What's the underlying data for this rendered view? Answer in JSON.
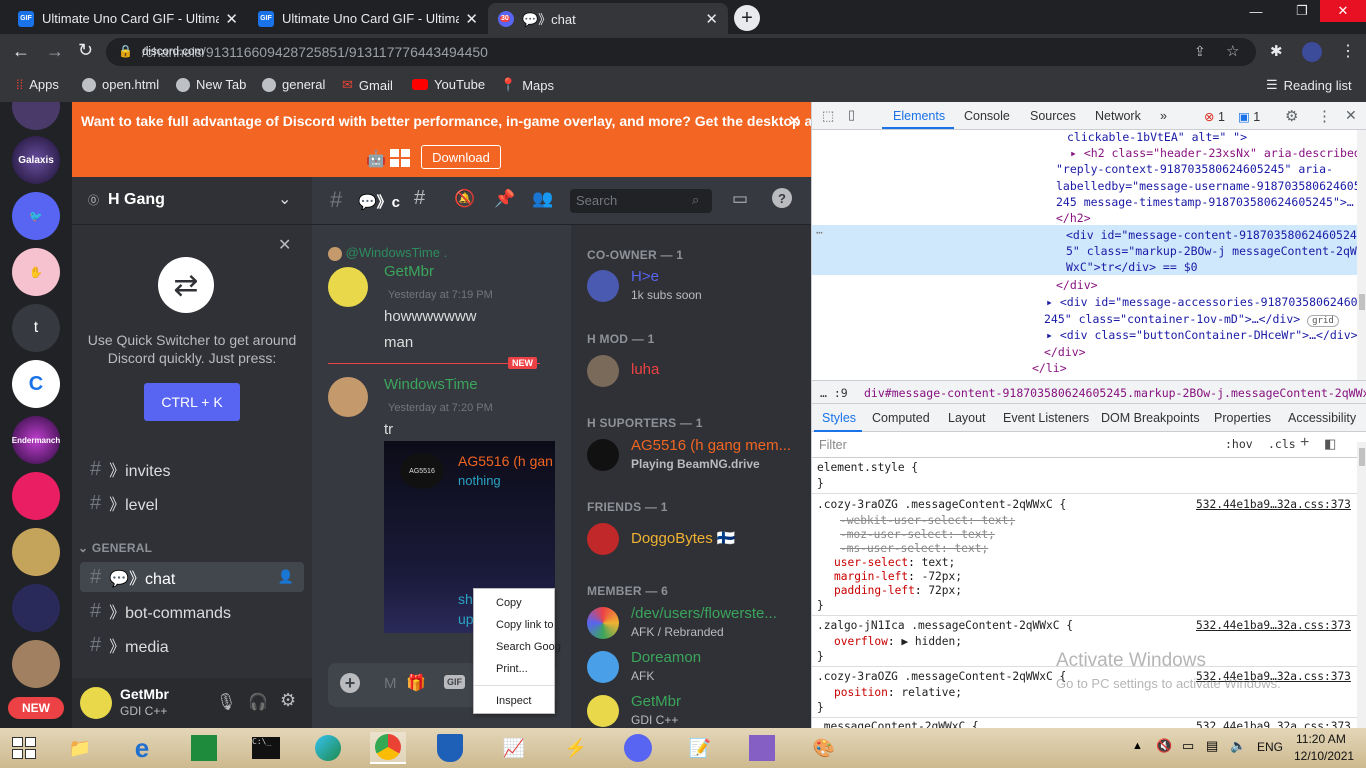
{
  "browser": {
    "tabs": [
      {
        "title": "Ultimate Uno Card GIF - Ultimate",
        "favicon": "GIF",
        "active": false
      },
      {
        "title": "Ultimate Uno Card GIF - Ultimate",
        "favicon": "GIF",
        "active": false
      },
      {
        "title": "💬》chat",
        "favicon": "30",
        "active": true
      }
    ],
    "url_domain": "discord.com",
    "url_path": "/channels/913116609428725851/913117776443494450",
    "bookmarks": [
      "Apps",
      "open.html",
      "New Tab",
      "general",
      "Gmail",
      "YouTube",
      "Maps"
    ],
    "reading_list": "Reading list"
  },
  "discord": {
    "banner": {
      "text": "Want to take full advantage of Discord with better performance, in-game overlay, and more? Get the desktop app!",
      "download": "Download"
    },
    "server_name": "H Gang",
    "channel_header": "💬》ch",
    "search_placeholder": "Search",
    "quick_switcher": {
      "text": "Use Quick Switcher to get around Discord quickly. Just press:",
      "button": "CTRL + K"
    },
    "channels_top": [
      {
        "label": "》invites"
      },
      {
        "label": "》level"
      }
    ],
    "category_general": "GENERAL",
    "channels_general": [
      {
        "label": "💬》chat",
        "active": true
      },
      {
        "label": "》bot-commands",
        "active": false
      },
      {
        "label": "》media",
        "active": false
      }
    ],
    "user": {
      "name": "GetMbr",
      "tag": "GDI C++"
    },
    "new_badge": "NEW",
    "messages": {
      "reply_to": "@WindowsTime .",
      "m1": {
        "author": "GetMbr",
        "time": "Yesterday at 7:19 PM",
        "lines": [
          "howwwwwww",
          "man"
        ]
      },
      "divider": "NEW",
      "m2": {
        "author": "WindowsTime",
        "time": "Yesterday at 7:20 PM",
        "text": "tr"
      },
      "embed": {
        "title": "AG5516 (h gan",
        "line": "nothing",
        "tail1": "sh",
        "tail2": "up",
        "logo": "AG5516"
      }
    },
    "context_menu": [
      "Copy",
      "Copy link to",
      "Search Goog",
      "Print...",
      "Inspect"
    ],
    "members": {
      "co_owner": {
        "header": "CO-OWNER — 1",
        "name": "H>e",
        "status": "1k subs soon"
      },
      "h_mod": {
        "header": "H MOD — 1",
        "name": "luha"
      },
      "supporters": {
        "header": "H SUPORTERS — 1",
        "name": "AG5516 (h gang mem...",
        "status": "Playing BeamNG.drive"
      },
      "friends": {
        "header": "FRIENDS — 1",
        "name": "DoggoBytes 🇫🇮"
      },
      "member": {
        "header": "MEMBER — 6",
        "list": [
          {
            "name": "/dev/users/flowerste...",
            "status": "AFK / Rebranded"
          },
          {
            "name": "Doreamon",
            "status": "AFK"
          },
          {
            "name": "GetMbr",
            "status": "GDI C++"
          }
        ]
      }
    },
    "server_initials": {
      "galaxis": "Galaxis",
      "t": "t",
      "endermanch": "Endermanch"
    }
  },
  "devtools": {
    "tabs": [
      "Elements",
      "Console",
      "Sources",
      "Network"
    ],
    "errors": "1",
    "messages": "1",
    "dom_lines": [
      "clickable-1bVtEA\" alt=\" \">",
      "<h2 class=\"header-23xsNx\" aria-describedby=",
      "\"reply-context-918703580624605245\" aria-",
      "labelledby=\"message-username-918703580624605",
      "245 message-timestamp-918703580624605245\">…",
      "</h2>",
      "<div id=\"message-content-91870358062460524",
      "5\" class=\"markup-2BOw-j messageContent-2qW",
      "WxC\">tr</div> == $0",
      "</div>",
      "<div id=\"message-accessories-918703580624605",
      "245\" class=\"container-1ov-mD\">…</div>",
      "<div class=\"buttonContainer-DHceWr\">…</div>",
      "</div>",
      "</li>"
    ],
    "grid_badge": "grid",
    "breadcrumb": "div#message-content-918703580624605245.markup-2BOw-j.messageContent-2qWWxC",
    "breadcrumb_prefix": "… :9",
    "style_tabs": [
      "Styles",
      "Computed",
      "Layout",
      "Event Listeners",
      "DOM Breakpoints",
      "Properties",
      "Accessibility"
    ],
    "filter_placeholder": "Filter",
    "hov": ":hov",
    "cls": ".cls",
    "rules": [
      {
        "selector": "element.style {",
        "source": "",
        "props": []
      },
      {
        "selector": ".cozy-3raOZG .messageContent-2qWWxC {",
        "source": "532.44e1ba9…32a.css:373",
        "props": [
          {
            "text": "-webkit-user-select: text;",
            "struck": true
          },
          {
            "text": "-moz-user-select: text;",
            "struck": true
          },
          {
            "text": "-ms-user-select: text;",
            "struck": true
          },
          {
            "name": "user-select",
            "value": "text;"
          },
          {
            "name": "margin-left",
            "value": "-72px;"
          },
          {
            "name": "padding-left",
            "value": "72px;"
          }
        ]
      },
      {
        "selector": ".zalgo-jN1Ica .messageContent-2qWWxC {",
        "source": "532.44e1ba9…32a.css:373",
        "props": [
          {
            "name": "overflow",
            "value": "▶ hidden;"
          }
        ]
      },
      {
        "selector": ".cozy-3raOZG .messageContent-2qWWxC {",
        "source": "532.44e1ba9…32a.css:373",
        "props": [
          {
            "name": "position",
            "value": "relative;"
          }
        ]
      },
      {
        "selector": ".messageContent-2qWWxC {",
        "source": "532.44e1ba9…32a.css:373",
        "props": []
      }
    ],
    "watermark_title": "Activate Windows",
    "watermark_sub": "Go to PC settings to activate Windows."
  },
  "taskbar": {
    "lang": "ENG",
    "time": "11:20 AM",
    "date": "12/10/2021"
  },
  "colors": {
    "discord_orange": "#f26522",
    "blurple": "#5865f2",
    "selected_dom": "#cfe8fc"
  }
}
